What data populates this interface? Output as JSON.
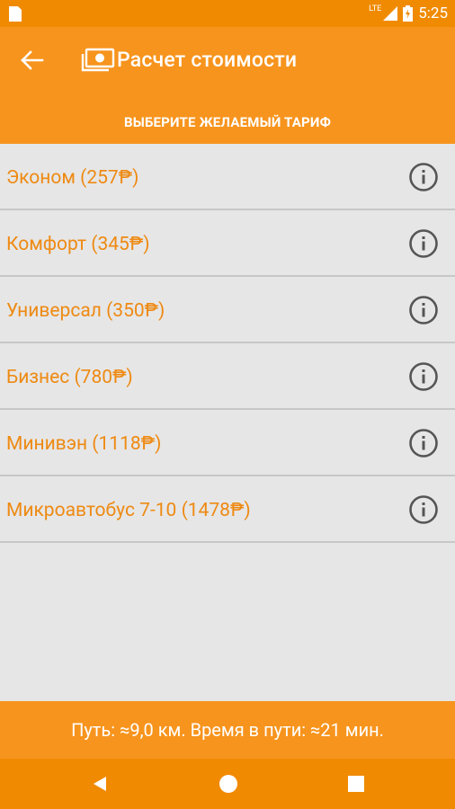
{
  "status_bar": {
    "network": "LTE",
    "time": "5:25"
  },
  "app_bar": {
    "title": "Расчет стоимости",
    "back_icon": "arrow-left-icon",
    "title_icon": "money-icon"
  },
  "subheader": {
    "text": "ВЫБЕРИТЕ ЖЕЛАЕМЫЙ ТАРИФ"
  },
  "tariffs": [
    {
      "label": "Эконом (257₱)"
    },
    {
      "label": "Комфорт (345₱)"
    },
    {
      "label": "Универсал (350₱)"
    },
    {
      "label": "Бизнес (780₱)"
    },
    {
      "label": "Минивэн (1118₱)"
    },
    {
      "label": "Микроавтобус 7-10 (1478₱)"
    }
  ],
  "footer": {
    "text": "Путь: ≈9,0 км. Время в пути: ≈21 мин."
  },
  "colors": {
    "primary": "#f7941d",
    "status": "#f08a00",
    "tariff_text": "#ee8a13",
    "background": "#e6e6e6",
    "divider": "#c7c7c7",
    "info_icon": "#555555"
  }
}
